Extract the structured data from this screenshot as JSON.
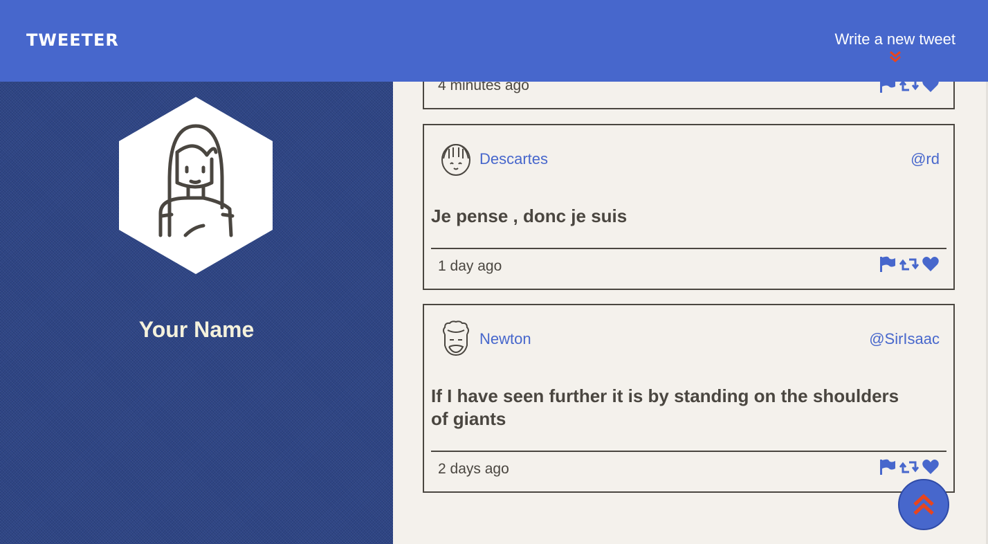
{
  "nav": {
    "brand": "TWEETER",
    "compose_label": "Write a new tweet"
  },
  "profile": {
    "name": "Your Name"
  },
  "tweets": [
    {
      "time": "4 minutes ago"
    },
    {
      "name": "Descartes",
      "handle": "@rd",
      "content": "Je pense , donc je suis",
      "time": "1 day ago"
    },
    {
      "name": "Newton",
      "handle": "@SirIsaac",
      "content": "If I have seen further it is by standing on the shoulders of giants",
      "time": "2 days ago"
    }
  ],
  "icons": {
    "flag": "flag-icon",
    "retweet": "retweet-icon",
    "like": "heart-icon",
    "compose_arrow": "double-chevron-down-icon",
    "scroll_top": "double-chevron-up-icon"
  },
  "colors": {
    "primary": "#4767cc",
    "accent": "#e8451e",
    "text": "#4a4640",
    "background": "#f4f1ec",
    "profile_bg": "#2e4585"
  }
}
